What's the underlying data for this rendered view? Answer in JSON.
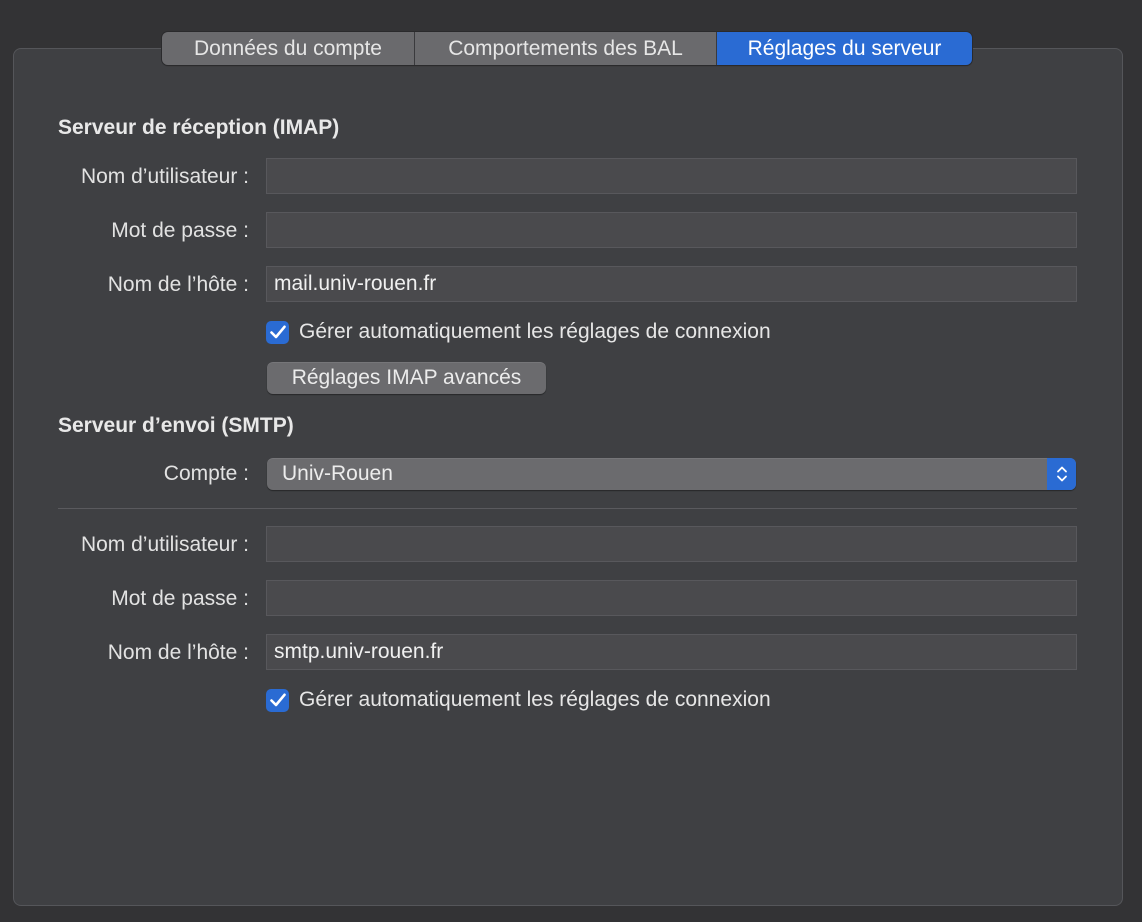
{
  "tabs": [
    {
      "label": "Données du compte",
      "active": false
    },
    {
      "label": "Comportements des BAL",
      "active": false
    },
    {
      "label": "Réglages du serveur",
      "active": true
    }
  ],
  "incoming": {
    "title": "Serveur de réception (IMAP)",
    "username_label": "Nom d’utilisateur :",
    "username_value": "",
    "password_label": "Mot de passe :",
    "password_value": "",
    "host_label": "Nom de l’hôte :",
    "host_value": "mail.univ-rouen.fr",
    "auto_manage_label": "Gérer automatiquement les réglages de connexion",
    "auto_manage_checked": true,
    "advanced_button": "Réglages IMAP avancés"
  },
  "outgoing": {
    "title": "Serveur d’envoi (SMTP)",
    "account_label": "Compte :",
    "account_value": "Univ-Rouen",
    "username_label": "Nom d’utilisateur :",
    "username_value": "",
    "password_label": "Mot de passe :",
    "password_value": "",
    "host_label": "Nom de l’hôte :",
    "host_value": "smtp.univ-rouen.fr",
    "auto_manage_label": "Gérer automatiquement les réglages de connexion",
    "auto_manage_checked": true
  },
  "colors": {
    "accent": "#2a6bd3",
    "background": "#333335",
    "panel": "#3f4043"
  },
  "icons": {
    "checkmark": "checkmark-icon",
    "stepper": "up-down-chevron-icon"
  }
}
